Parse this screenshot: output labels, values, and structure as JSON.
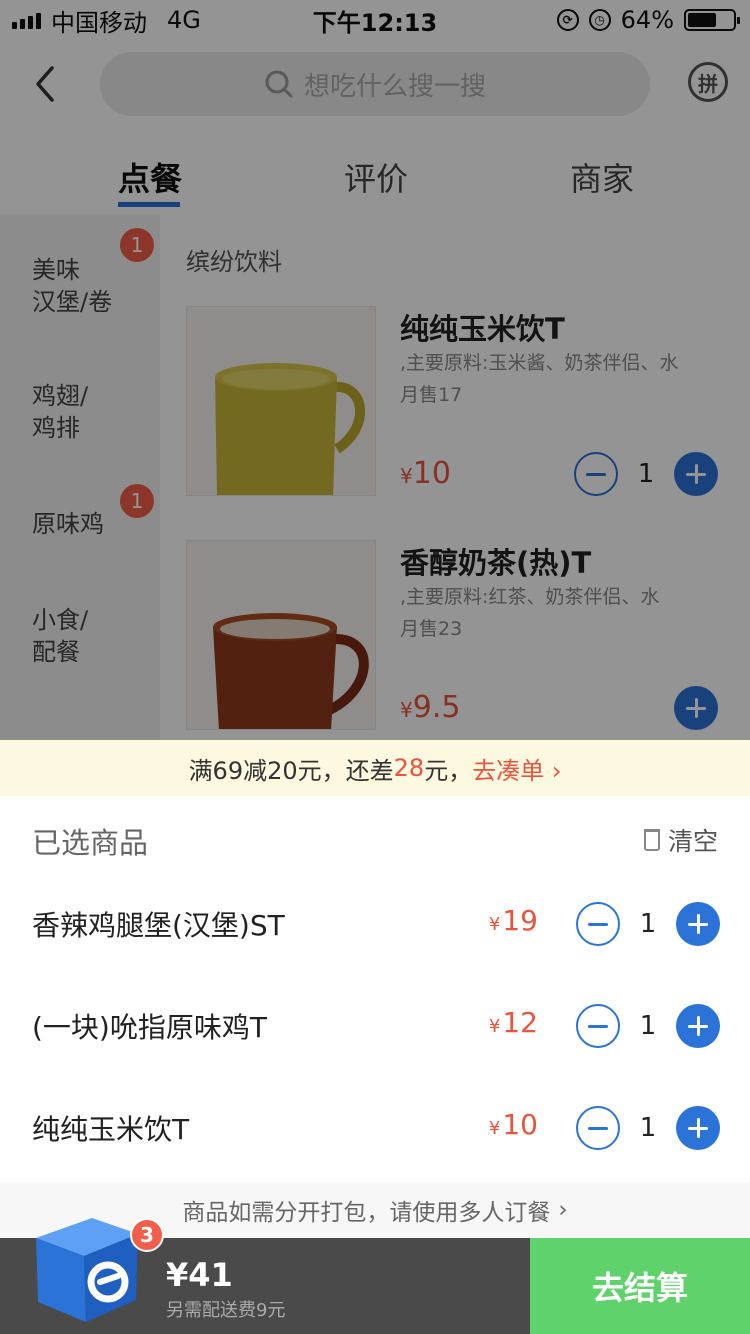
{
  "status_bar": {
    "carrier": "中国移动",
    "network": "4G",
    "time": "下午12:13",
    "battery": "64%"
  },
  "search": {
    "placeholder": "想吃什么搜一搜"
  },
  "pin_label": "拼",
  "tabs": [
    {
      "label": "点餐"
    },
    {
      "label": "评价"
    },
    {
      "label": "商家"
    }
  ],
  "sidebar": {
    "items": [
      {
        "label": "美味\n汉堡/卷",
        "badge": "1"
      },
      {
        "label": "鸡翅/\n鸡排",
        "badge": ""
      },
      {
        "label": "原味鸡",
        "badge": "1"
      },
      {
        "label": "小食/\n配餐",
        "badge": ""
      }
    ]
  },
  "menu": {
    "section_title": "缤纷饮料",
    "products": [
      {
        "name": "纯纯玉米饮T",
        "desc": ",主要原料:玉米酱、奶茶伴侣、水",
        "sales": "月售17",
        "currency": "¥",
        "price": "10",
        "qty": "1"
      },
      {
        "name": "香醇奶茶(热)T",
        "desc": ",主要原料:红茶、奶茶伴侣、水",
        "sales": "月售23",
        "currency": "¥",
        "price": "9.5",
        "qty": ""
      }
    ]
  },
  "promo": {
    "prefix": "满69减20元，还差",
    "amount": "28",
    "suffix": "元，",
    "link": "去凑单 ›"
  },
  "cart": {
    "title": "已选商品",
    "clear_label": "清空",
    "items": [
      {
        "name": "香辣鸡腿堡(汉堡)ST",
        "currency": "¥",
        "price": "19",
        "qty": "1"
      },
      {
        "name": "(一块)吮指原味鸡T",
        "currency": "¥",
        "price": "12",
        "qty": "1"
      },
      {
        "name": "纯纯玉米饮T",
        "currency": "¥",
        "price": "10",
        "qty": "1"
      }
    ],
    "split_tip": "商品如需分开打包，请使用多人订餐",
    "split_arrow": "›"
  },
  "bottom": {
    "count": "3",
    "total": "¥41",
    "delivery_fee": "另需配送费9元",
    "checkout_label": "去结算"
  },
  "colors": {
    "accent": "#2b73d6",
    "price": "#e8543e",
    "checkout": "#5fd26b",
    "badge": "#f15e4a"
  },
  "progress": {
    "battery_level": 0.64
  }
}
